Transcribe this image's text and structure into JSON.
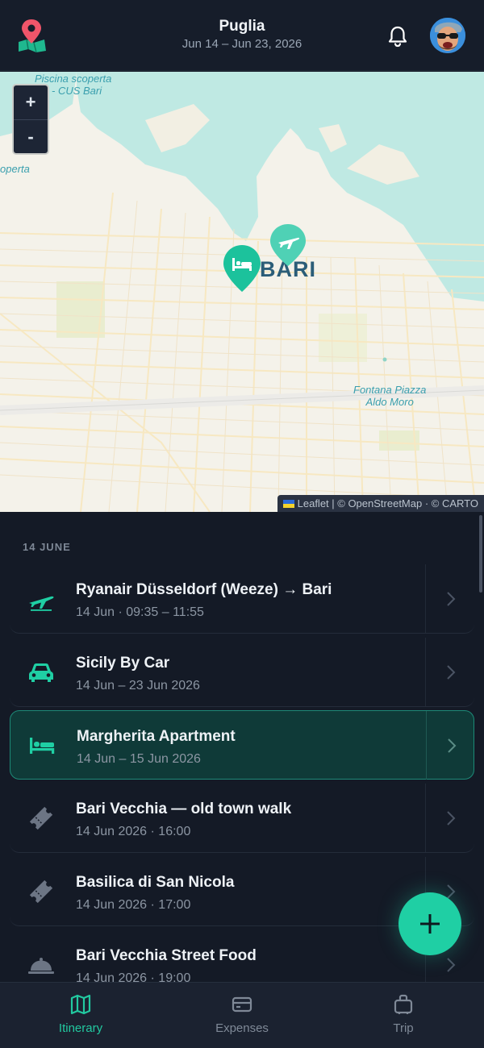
{
  "header": {
    "title": "Puglia",
    "dates": "Jun 14 – Jun 23, 2026",
    "logo_icon": "map-pin-logo-icon",
    "bell_icon": "bell-icon"
  },
  "map": {
    "zoom_in": "+",
    "zoom_out": "-",
    "labels": {
      "pool_line1": "Piscina scoperta",
      "pool_line2": "- CUS Bari",
      "pool_fragment": "operta",
      "city": "BARI",
      "piazza_line1": "Fontana Piazza",
      "piazza_line2": "Aldo Moro"
    },
    "attribution": "Leaflet | © OpenStreetMap · © CARTO",
    "pins": [
      {
        "icon": "hotel-icon",
        "selected": true
      },
      {
        "icon": "plane-icon",
        "selected": false
      }
    ]
  },
  "itinerary": {
    "day_heading": "14 JUNE",
    "items": [
      {
        "icon": "plane-icon",
        "name": "Ryanair Düsseldorf (Weeze) → Bari",
        "subtitle": "14 Jun · 09:35 – 11:55",
        "active": false
      },
      {
        "icon": "car-icon",
        "name": "Sicily By Car",
        "subtitle": "14 Jun – 23 Jun 2026",
        "active": false
      },
      {
        "icon": "bed-icon",
        "name": "Margherita Apartment",
        "subtitle": "14 Jun – 15 Jun 2026",
        "active": true
      },
      {
        "icon": "ticket-icon",
        "name": "Bari Vecchia — old town walk",
        "subtitle": "14 Jun 2026 · 16:00",
        "active": false
      },
      {
        "icon": "ticket-icon",
        "name": "Basilica di San Nicola",
        "subtitle": "14 Jun 2026 · 17:00",
        "active": false
      },
      {
        "icon": "food-cloche-icon",
        "name": "Bari Vecchia Street Food",
        "subtitle": "14 Jun 2026 · 19:00",
        "active": false
      }
    ]
  },
  "fab": {
    "icon": "plus-icon"
  },
  "nav": {
    "itinerary": "Itinerary",
    "expenses": "Expenses",
    "trip": "Trip"
  },
  "colors": {
    "accent": "#22c9a0",
    "background": "#141a26",
    "active_item": "#0f3a38"
  }
}
